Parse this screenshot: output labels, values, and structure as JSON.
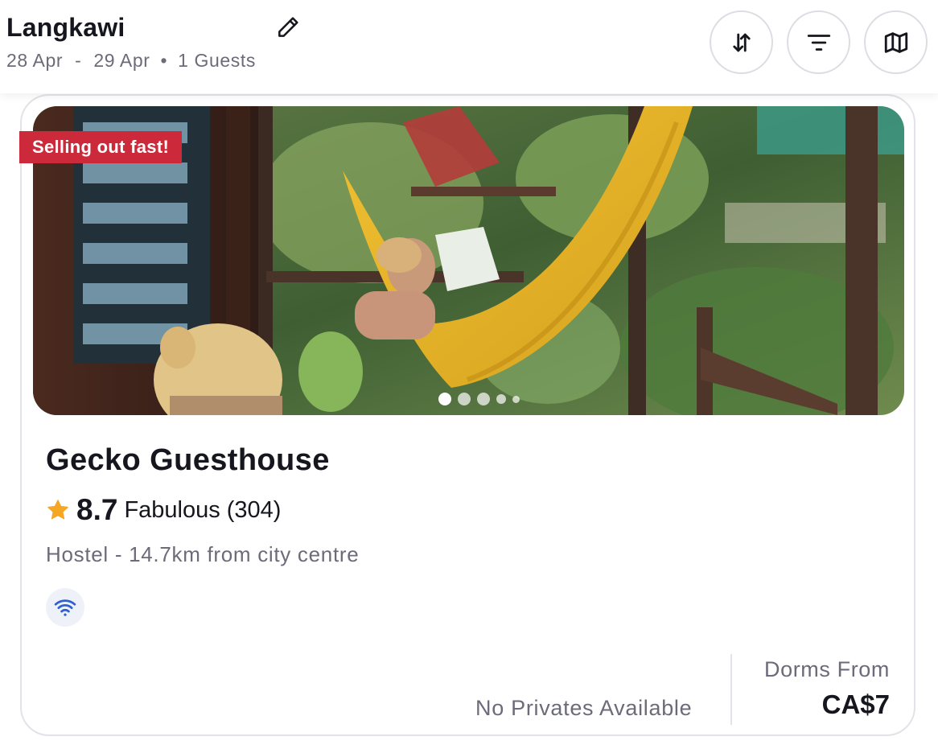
{
  "header": {
    "city": "Langkawi",
    "date_from": "28 Apr",
    "date_separator": "-",
    "date_to": "29 Apr",
    "guests": "1 Guests",
    "icons": {
      "edit": "pencil-icon",
      "sort": "sort-arrows-icon",
      "filter": "filter-icon",
      "map": "map-icon"
    }
  },
  "listing": {
    "badge": "Selling out fast!",
    "name": "Gecko Guesthouse",
    "rating_score": "8.7",
    "rating_label": "Fabulous",
    "review_count": "(304)",
    "type_distance": "Hostel - 14.7km from city centre",
    "amenity_icon": "wifi-icon",
    "privates_text": "No Privates Available",
    "dorms_label": "Dorms From",
    "dorms_price": "CA$7",
    "carousel": {
      "total_dots": 5,
      "active_index": 0
    },
    "colors": {
      "badge_bg": "#cc2a3a",
      "star": "#f5a623",
      "wifi": "#2f5fd0"
    }
  }
}
